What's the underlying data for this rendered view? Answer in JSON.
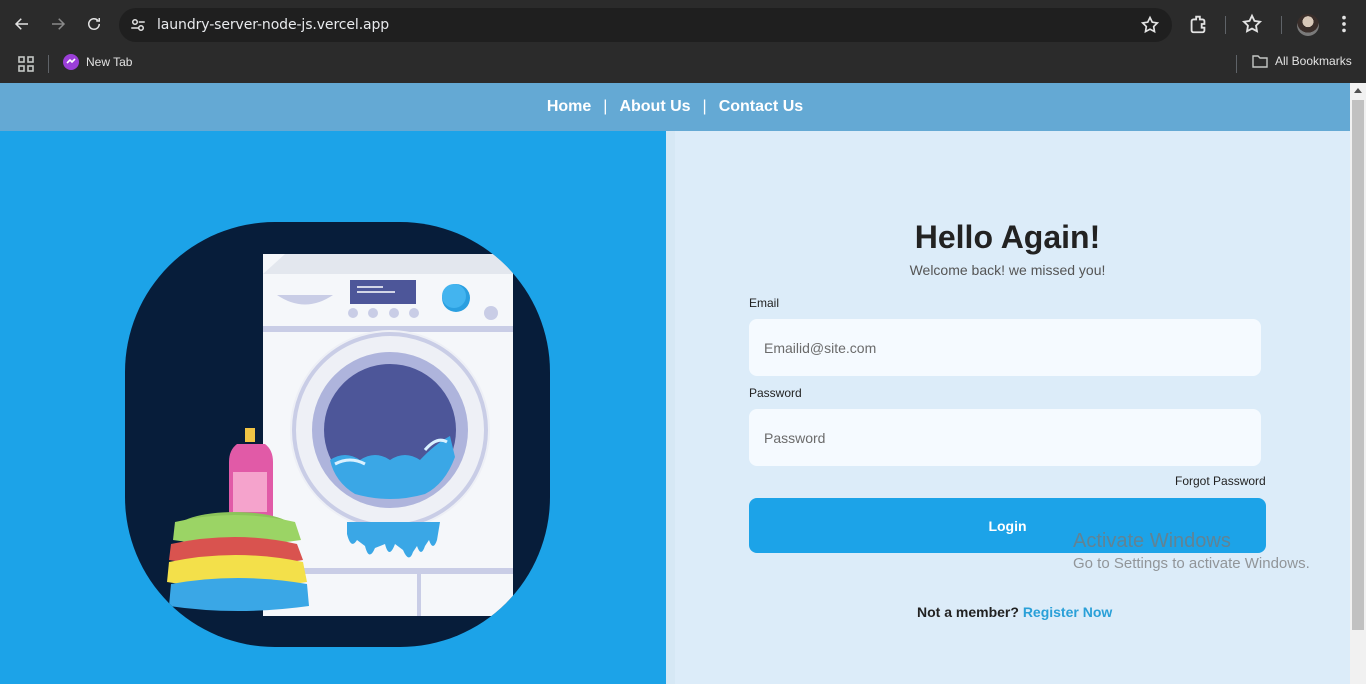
{
  "browser": {
    "url": "laundry-server-node-js.vercel.app",
    "bookmarks": [
      {
        "label": "New Tab"
      }
    ],
    "all_bookmarks_label": "All Bookmarks"
  },
  "site_nav": {
    "items": [
      {
        "label": "Home"
      },
      {
        "label": "About Us"
      },
      {
        "label": "Contact Us"
      }
    ],
    "separator": "|"
  },
  "login": {
    "title": "Hello Again!",
    "subtitle": "Welcome back! we missed you!",
    "email_label": "Email",
    "email_placeholder": "Emailid@site.com",
    "email_value": "",
    "password_label": "Password",
    "password_placeholder": "Password",
    "password_value": "",
    "forgot_label": "Forgot Password",
    "login_label": "Login",
    "register_prompt": "Not a member?",
    "register_link": "Register Now"
  },
  "os_watermark": {
    "title": "Activate Windows",
    "subtitle": "Go to Settings to activate Windows."
  },
  "colors": {
    "primary": "#1ca3e8",
    "nav_bg": "#64a9d4",
    "form_bg": "#dcecf9",
    "illustration_bg": "#071d3a"
  }
}
